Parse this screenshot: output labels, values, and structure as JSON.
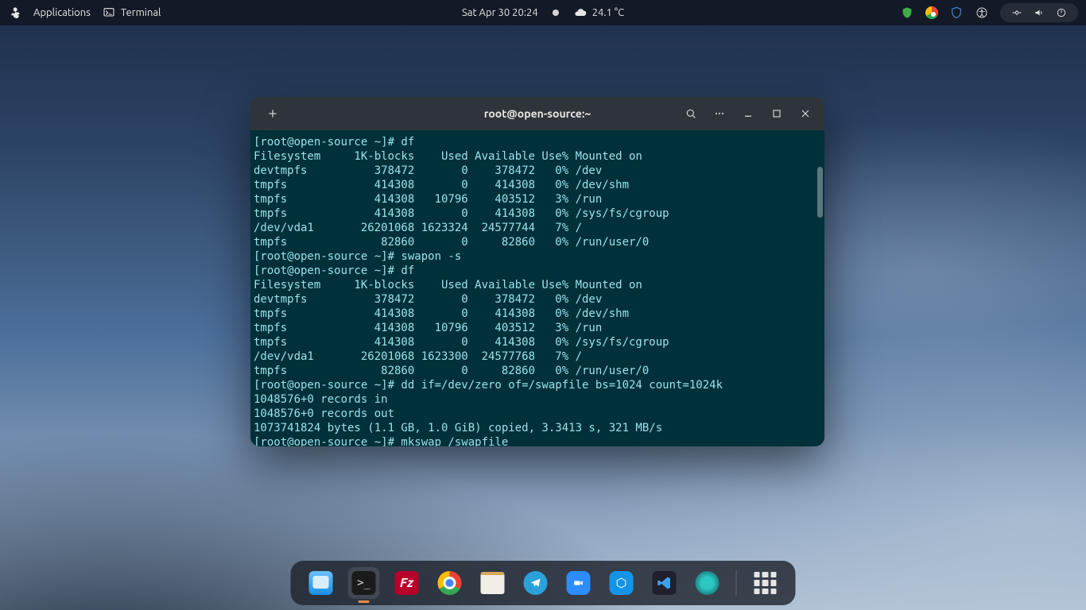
{
  "panel": {
    "applications": "Applications",
    "terminal": "Terminal",
    "datetime": "Sat Apr 30  20:24",
    "temperature": "24.1 °C"
  },
  "window": {
    "title": "root@open-source:~"
  },
  "terminal": {
    "text": "[root@open-source ~]# df\nFilesystem     1K-blocks    Used Available Use% Mounted on\ndevtmpfs          378472       0    378472   0% /dev\ntmpfs             414308       0    414308   0% /dev/shm\ntmpfs             414308   10796    403512   3% /run\ntmpfs             414308       0    414308   0% /sys/fs/cgroup\n/dev/vda1       26201068 1623324  24577744   7% /\ntmpfs              82860       0     82860   0% /run/user/0\n[root@open-source ~]# swapon -s\n[root@open-source ~]# df\nFilesystem     1K-blocks    Used Available Use% Mounted on\ndevtmpfs          378472       0    378472   0% /dev\ntmpfs             414308       0    414308   0% /dev/shm\ntmpfs             414308   10796    403512   3% /run\ntmpfs             414308       0    414308   0% /sys/fs/cgroup\n/dev/vda1       26201068 1623300  24577768   7% /\ntmpfs              82860       0     82860   0% /run/user/0\n[root@open-source ~]# dd if=/dev/zero of=/swapfile bs=1024 count=1024k\n1048576+0 records in\n1048576+0 records out\n1073741824 bytes (1.1 GB, 1.0 GiB) copied, 3.3413 s, 321 MB/s\n[root@open-source ~]# mkswap /swapfile"
  },
  "dock": {
    "items": [
      {
        "name": "files",
        "label": "Files"
      },
      {
        "name": "terminal",
        "label": "Terminal"
      },
      {
        "name": "filezilla",
        "label": "FileZilla"
      },
      {
        "name": "chrome",
        "label": "Google Chrome"
      },
      {
        "name": "notes",
        "label": "Text Editor"
      },
      {
        "name": "telegram",
        "label": "Telegram"
      },
      {
        "name": "zoom",
        "label": "Zoom"
      },
      {
        "name": "syncthing",
        "label": "Syncthing"
      },
      {
        "name": "vscode",
        "label": "VS Code"
      },
      {
        "name": "settings",
        "label": "Settings"
      },
      {
        "name": "apps",
        "label": "Show Applications"
      }
    ]
  }
}
